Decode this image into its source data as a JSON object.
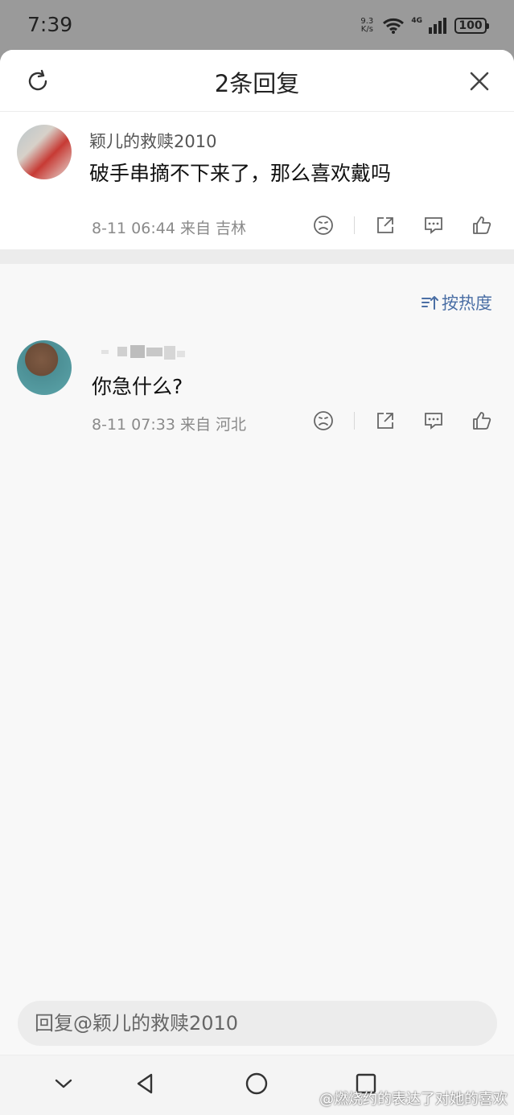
{
  "status_bar": {
    "time": "7:39",
    "net_speed_top": "9.3",
    "net_speed_bottom": "K/s",
    "network": "4G",
    "battery": "100"
  },
  "header": {
    "title": "2条回复"
  },
  "main_comment": {
    "username": "颖儿的救赎2010",
    "text": "破手串摘不下来了，那么喜欢戴吗",
    "meta": "8-11 06:44  来自 吉林"
  },
  "sort": {
    "label": "按热度"
  },
  "reply": {
    "text": "你急什么?",
    "meta": "8-11 07:33  来自 河北"
  },
  "reply_input": {
    "placeholder": "回复@颖儿的救赎2010"
  },
  "watermark": "@燃烧约的表达了对她的喜欢",
  "colors": {
    "sort_link": "#4b6fa5",
    "background": "#f8f8f8",
    "text": "#111111"
  }
}
